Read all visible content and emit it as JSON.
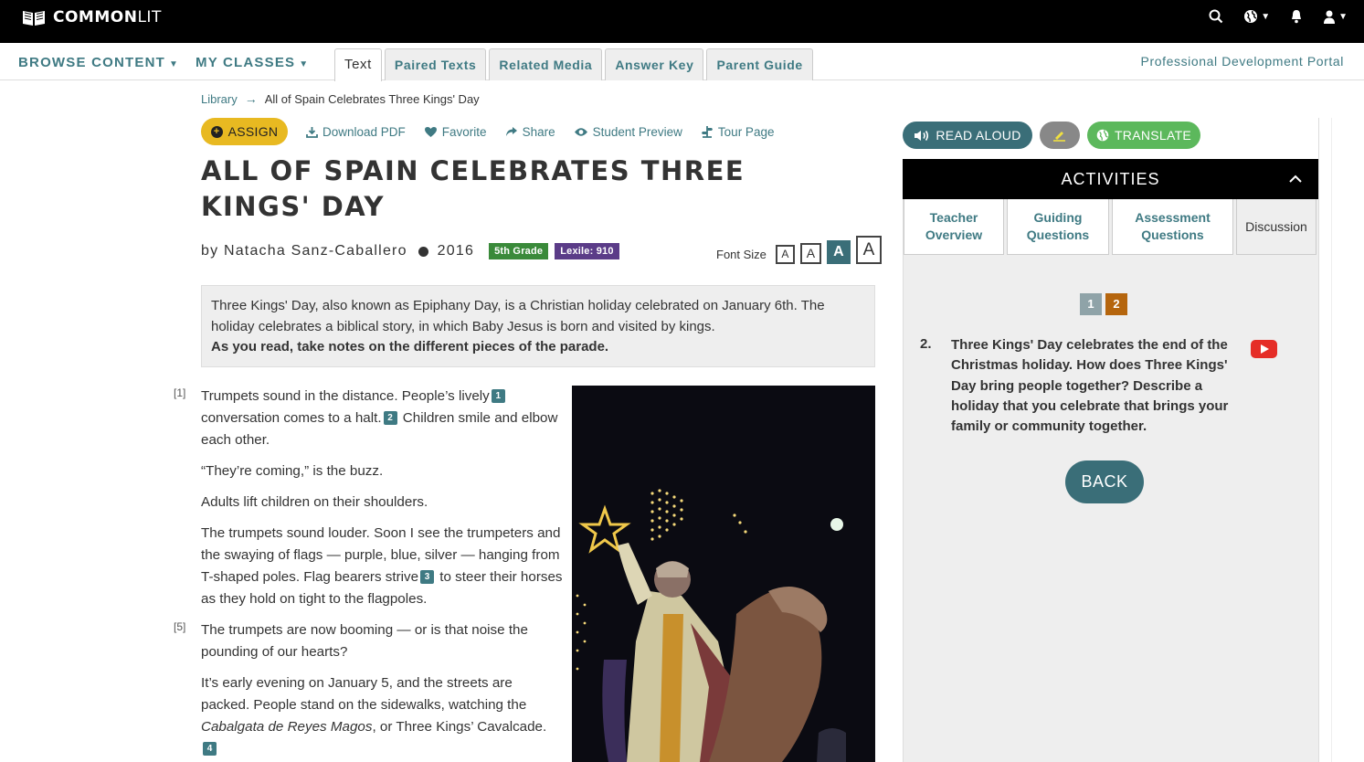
{
  "brand": {
    "name_bold": "COMMON",
    "name_light": "LIT"
  },
  "topbar": {
    "icons": [
      "search-icon",
      "globe-icon",
      "bell-icon",
      "user-icon"
    ]
  },
  "nav": {
    "browse": "BROWSE CONTENT",
    "classes": "MY CLASSES",
    "tabs": [
      {
        "label": "Text",
        "active": true
      },
      {
        "label": "Paired Texts"
      },
      {
        "label": "Related Media"
      },
      {
        "label": "Answer Key"
      },
      {
        "label": "Parent Guide"
      }
    ],
    "pd_portal": "Professional Development Portal"
  },
  "breadcrumb": {
    "library": "Library",
    "current": "All of Spain Celebrates Three Kings' Day"
  },
  "actions": {
    "assign": "ASSIGN",
    "download": "Download PDF",
    "favorite": "Favorite",
    "share": "Share",
    "preview": "Student Preview",
    "tour": "Tour Page"
  },
  "article": {
    "title": "ALL OF SPAIN CELEBRATES THREE KINGS' DAY",
    "author": "by Natacha Sanz-Caballero",
    "year": "2016",
    "grade": "5th Grade",
    "lexile": "Lexile: 910",
    "font_size_label": "Font Size",
    "font_size_options": [
      "A",
      "A",
      "A",
      "A"
    ],
    "intro": "Three Kings' Day, also known as Epiphany Day, is a Christian holiday celebrated on January 6th. The holiday celebrates a biblical story, in which Baby Jesus is born and visited by kings.",
    "intro_bold": "As you read, take notes on the different pieces of the parade.",
    "para_numbers": [
      "[1]",
      "[5]"
    ],
    "p1a": "Trumpets sound in the distance. People’s lively",
    "p1b": "conversation comes to a halt.",
    "p1c": "Children smile and elbow each other.",
    "p2": "“They’re coming,” is the buzz.",
    "p3": "Adults lift children on their shoulders.",
    "p4a": "The trumpets sound louder. Soon I see the trumpeters and the swaying of flags — purple, blue, silver — hanging from T-shaped poles. Flag bearers strive",
    "p4b": "to steer their horses as they hold on tight to the flagpoles.",
    "p5": "The trumpets are now booming — or is that noise the pounding of our hearts?",
    "p6a": "It’s early evening on January 5, and the streets are packed. People stand on the sidewalks, watching the",
    "p6_italic": "Cabalgata de Reyes Magos",
    "p6b": ", or Three Kings’ Cavalcade.",
    "footnotes": [
      "1",
      "2",
      "3",
      "4"
    ]
  },
  "panel": {
    "read_aloud": "READ ALOUD",
    "translate": "TRANSLATE",
    "activities": "ACTIVITIES",
    "tabs": [
      "Teacher Overview",
      "Guiding Questions",
      "Assessment Questions",
      "Discussion"
    ],
    "active_tab": "Discussion",
    "pages": [
      "1",
      "2"
    ],
    "current_page": "2",
    "question_number": "2.",
    "question": "Three Kings' Day celebrates the end of the Christmas holiday. How does Three Kings' Day bring people together? Describe a holiday that you celebrate that brings your family or community together.",
    "back": "BACK"
  }
}
